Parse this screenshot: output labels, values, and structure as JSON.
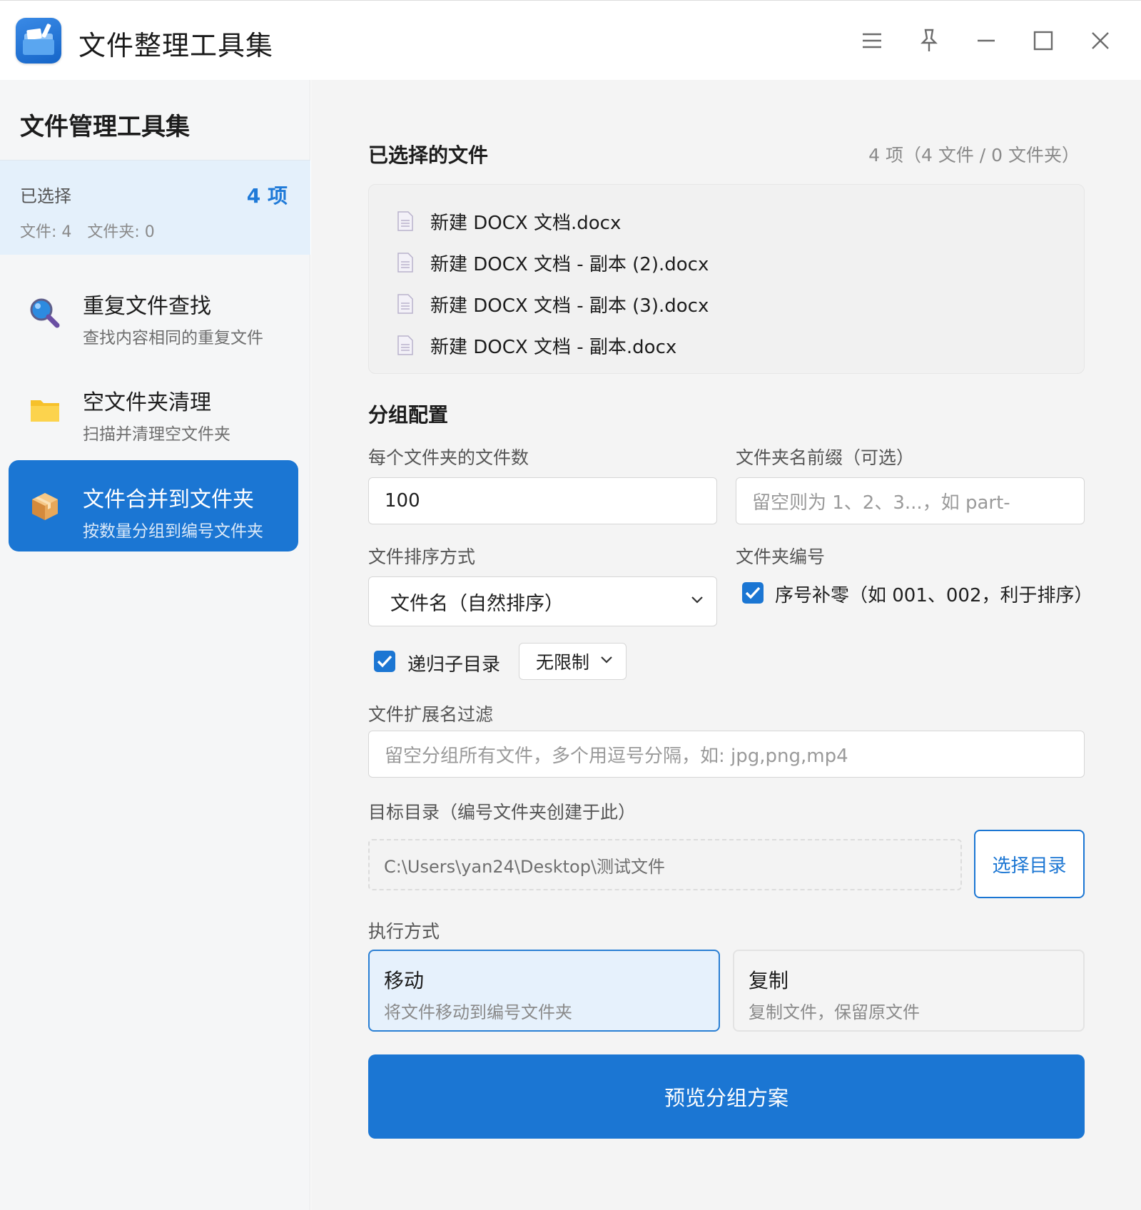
{
  "app": {
    "title": "文件整理工具集"
  },
  "window_controls": [
    "menu-icon",
    "pin-icon",
    "minimize-icon",
    "maximize-icon",
    "close-icon"
  ],
  "sidebar": {
    "title": "文件管理工具集",
    "selection": {
      "label": "已选择",
      "count": "4 项",
      "files": "文件: 4",
      "folders": "文件夹: 0"
    },
    "items": [
      {
        "title": "重复文件查找",
        "subtitle": "查找内容相同的重复文件",
        "icon": "magnifier-icon",
        "active": false
      },
      {
        "title": "空文件夹清理",
        "subtitle": "扫描并清理空文件夹",
        "icon": "folder-icon",
        "active": false
      },
      {
        "title": "文件合并到文件夹",
        "subtitle": "按数量分组到编号文件夹",
        "icon": "package-icon",
        "active": true
      }
    ]
  },
  "main": {
    "selected_files": {
      "title": "已选择的文件",
      "count_info": "4 项（4 文件 / 0 文件夹）",
      "files": [
        "新建 DOCX 文档.docx",
        "新建 DOCX 文档 - 副本 (2).docx",
        "新建 DOCX 文档 - 副本 (3).docx",
        "新建 DOCX 文档 - 副本.docx"
      ]
    },
    "group_config": {
      "title": "分组配置",
      "files_per_folder": {
        "label": "每个文件夹的文件数",
        "value": "100"
      },
      "folder_prefix": {
        "label": "文件夹名前缀（可选）",
        "placeholder": "留空则为 1、2、3...，如 part-"
      },
      "sort_order": {
        "label": "文件排序方式",
        "selected": "文件名（自然排序）"
      },
      "folder_numbering": {
        "label": "文件夹编号",
        "zero_pad_label": "序号补零（如 001、002，利于排序）",
        "zero_pad_checked": true
      },
      "recursive": {
        "label": "递归子目录",
        "checked": true,
        "depth_selected": "无限制"
      },
      "extension_filter": {
        "label": "文件扩展名过滤",
        "placeholder": "留空分组所有文件，多个用逗号分隔，如: jpg,png,mp4"
      },
      "target_dir": {
        "label": "目标目录（编号文件夹创建于此）",
        "value": "C:\\Users\\yan24\\Desktop\\测试文件",
        "button": "选择目录"
      },
      "mode": {
        "label": "执行方式",
        "options": [
          {
            "title": "移动",
            "desc": "将文件移动到编号文件夹",
            "selected": true
          },
          {
            "title": "复制",
            "desc": "复制文件，保留原文件",
            "selected": false
          }
        ]
      }
    },
    "preview_button": "预览分组方案"
  },
  "colors": {
    "accent": "#1b76d3",
    "active_card_bg": "#e6f1fc",
    "selection_bg": "#e4f0fb"
  }
}
